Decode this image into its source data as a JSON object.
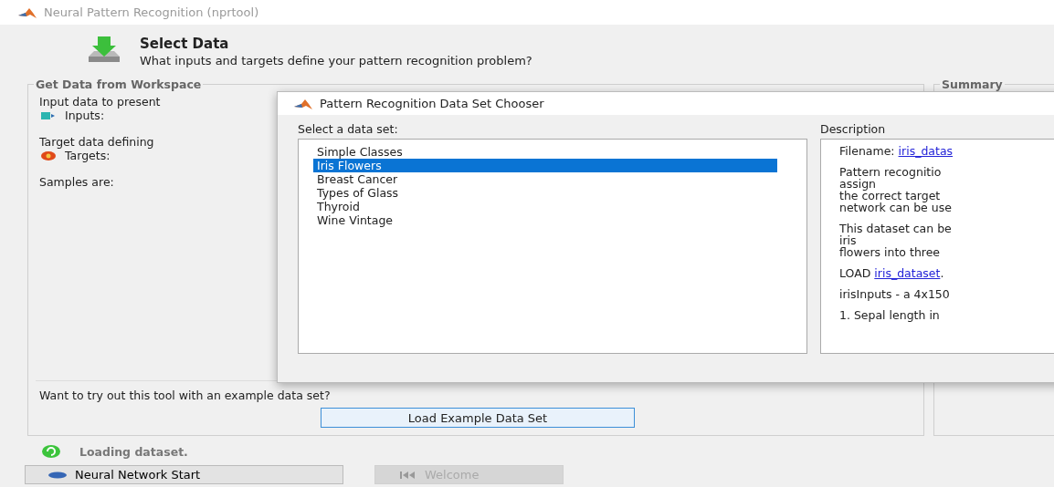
{
  "window": {
    "title": "Neural Pattern Recognition (nprtool)"
  },
  "header": {
    "title": "Select Data",
    "subtitle": "What inputs and targets define your pattern recognition problem?"
  },
  "workspace_group": {
    "title": "Get Data from Workspace",
    "input_prompt": "Input data to present",
    "inputs_label": "Inputs:",
    "target_prompt": "Target data defining",
    "targets_label": "Targets:",
    "samples_label": "Samples are:",
    "example_prompt": "Want to try out this tool with an example data set?",
    "example_button": "Load Example Data Set"
  },
  "summary_group": {
    "title": "Summary"
  },
  "status": {
    "text": "Loading dataset."
  },
  "nav_buttons": [
    {
      "label": "Neural Network Start",
      "disabled": false,
      "kind": "start"
    },
    {
      "label": "Welcome",
      "disabled": true,
      "kind": "welcome"
    }
  ],
  "dialog": {
    "title": "Pattern Recognition Data Set Chooser",
    "list_label": "Select a data set:",
    "datasets": [
      {
        "label": "Simple Classes",
        "selected": false
      },
      {
        "label": "Iris Flowers",
        "selected": true
      },
      {
        "label": "Breast Cancer",
        "selected": false
      },
      {
        "label": "Types of Glass",
        "selected": false
      },
      {
        "label": "Thyroid",
        "selected": false
      },
      {
        "label": "Wine Vintage",
        "selected": false
      }
    ],
    "description_label": "Description",
    "description": [
      {
        "kind": "link",
        "text": "Filename: ",
        "link": "iris_datas"
      },
      {
        "kind": "text",
        "lines": [
          "Pattern recognitio",
          "assign",
          "the correct target",
          "network can be use"
        ]
      },
      {
        "kind": "text",
        "lines": [
          "This dataset can be",
          "iris",
          "flowers into three"
        ]
      },
      {
        "kind": "link",
        "text": "LOAD ",
        "link": "iris_dataset",
        "after": "."
      },
      {
        "kind": "text",
        "lines": [
          "irisInputs - a 4x150"
        ]
      },
      {
        "kind": "text",
        "lines": [
          "1. Sepal length in"
        ]
      }
    ]
  }
}
